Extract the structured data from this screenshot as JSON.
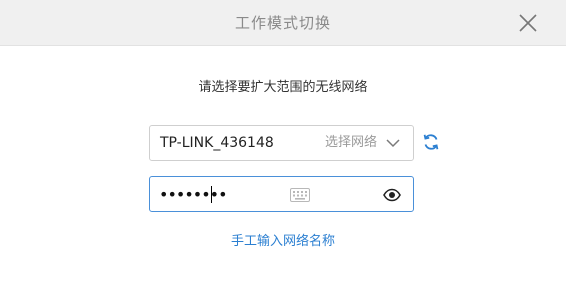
{
  "window": {
    "title": "工作模式切换",
    "close_icon": "close-icon"
  },
  "content": {
    "prompt": "请选择要扩大范围的无线网络"
  },
  "network_select": {
    "value": "TP-LINK_436148",
    "action_label": "选择网络",
    "icon": "chevron-down-icon",
    "refresh_icon": "refresh-icon"
  },
  "password": {
    "value": "••••••••",
    "keyboard_icon": "keyboard-icon",
    "visibility_icon": "eye-icon"
  },
  "links": {
    "manual_entry": "手工输入网络名称"
  },
  "colors": {
    "accent": "#2b7fd1",
    "focus_border": "#4a90d9",
    "titlebar_bg": "#f0f0f0"
  }
}
